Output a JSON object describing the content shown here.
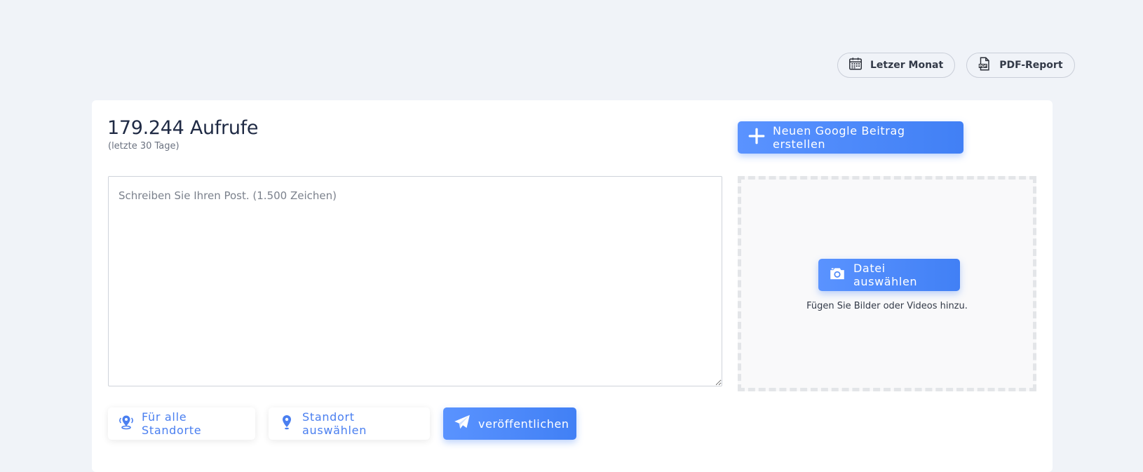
{
  "header": {
    "period_label": "Letzer Monat",
    "pdf_label": "PDF-Report"
  },
  "stats": {
    "views_title": "179.244 Aufrufe",
    "views_subtitle": "(letzte 30 Tage)"
  },
  "composer": {
    "new_post_label": "Neuen Google Beitrag erstellen",
    "text_placeholder": "Schreiben Sie Ihren Post. (1.500 Zeichen)",
    "text_value": "",
    "file_button_label": "Datei auswählen",
    "file_hint": "Fügen Sie Bilder oder Videos hinzu."
  },
  "actions": {
    "all_locations_label": "Für alle Standorte",
    "choose_location_label": "Standort auswählen",
    "publish_label": "veröffentlichen"
  },
  "icons": {
    "period": "calendar-icon",
    "pdf": "pdf-file-icon",
    "new_post": "plus-icon",
    "file": "camera-icon",
    "all_locations": "multi-location-pin-icon",
    "choose_location": "location-pin-icon",
    "publish": "paper-plane-icon"
  },
  "colors": {
    "accent": "#4a80f5",
    "background": "#f0f3f8",
    "card": "#ffffff"
  }
}
